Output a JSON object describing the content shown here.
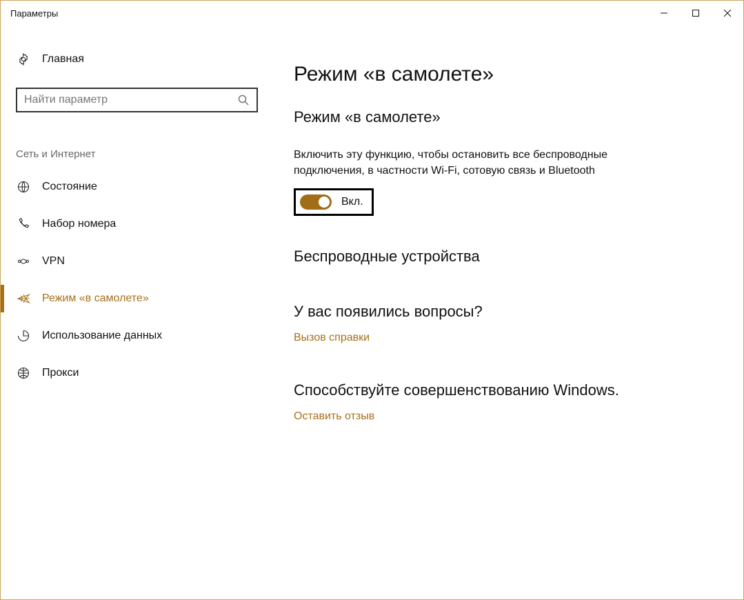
{
  "window": {
    "title": "Параметры"
  },
  "sidebar": {
    "home_label": "Главная",
    "search_placeholder": "Найти параметр",
    "category_label": "Сеть и Интернет",
    "items": [
      {
        "label": "Состояние"
      },
      {
        "label": "Набор номера"
      },
      {
        "label": "VPN"
      },
      {
        "label": "Режим «в самолете»"
      },
      {
        "label": "Использование данных"
      },
      {
        "label": "Прокси"
      }
    ],
    "active_index": 3
  },
  "main": {
    "page_title": "Режим «в самолете»",
    "sub_title": "Режим «в самолете»",
    "description": "Включить эту функцию, чтобы остановить все беспроводные подключения, в частности Wi-Fi, сотовую связь и Bluetooth",
    "toggle_state_label": "Вкл.",
    "toggle_on": true,
    "wireless_title": "Беспроводные устройства",
    "help_title": "У вас появились вопросы?",
    "help_link": "Вызов справки",
    "feedback_title": "Способствуйте совершенствованию Windows.",
    "feedback_link": "Оставить отзыв"
  },
  "colors": {
    "accent": "#a6701a"
  }
}
